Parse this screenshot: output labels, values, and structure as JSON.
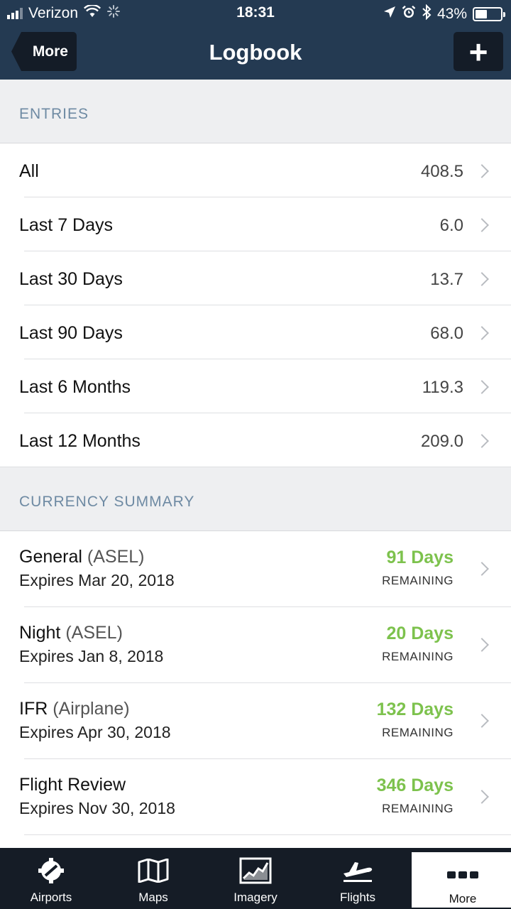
{
  "status_bar": {
    "carrier": "Verizon",
    "time": "18:31",
    "battery_percent": "43%",
    "icons": [
      "signal-icon",
      "wifi-icon",
      "activity-icon",
      "location-icon",
      "alarm-icon",
      "bluetooth-icon",
      "battery-icon"
    ]
  },
  "nav": {
    "back_label": "More",
    "title": "Logbook",
    "add_label": "+"
  },
  "entries": {
    "header": "ENTRIES",
    "items": [
      {
        "label": "All",
        "value": "408.5"
      },
      {
        "label": "Last 7 Days",
        "value": "6.0"
      },
      {
        "label": "Last 30 Days",
        "value": "13.7"
      },
      {
        "label": "Last 90 Days",
        "value": "68.0"
      },
      {
        "label": "Last 6 Months",
        "value": "119.3"
      },
      {
        "label": "Last 12 Months",
        "value": "209.0"
      }
    ]
  },
  "currency": {
    "header": "CURRENCY SUMMARY",
    "accent_color": "#7dc24d",
    "items": [
      {
        "title": "General",
        "qualifier": "(ASEL)",
        "expires": "Expires Mar 20, 2018",
        "days": "91 Days",
        "remaining": "REMAINING"
      },
      {
        "title": "Night",
        "qualifier": "(ASEL)",
        "expires": "Expires Jan 8, 2018",
        "days": "20 Days",
        "remaining": "REMAINING"
      },
      {
        "title": "IFR",
        "qualifier": "(Airplane)",
        "expires": "Expires Apr 30, 2018",
        "days": "132 Days",
        "remaining": "REMAINING"
      },
      {
        "title": "Flight Review",
        "qualifier": "",
        "expires": "Expires Nov 30, 2018",
        "days": "346 Days",
        "remaining": "REMAINING"
      }
    ]
  },
  "tabs": [
    {
      "label": "Airports",
      "icon": "airport-icon"
    },
    {
      "label": "Maps",
      "icon": "map-icon"
    },
    {
      "label": "Imagery",
      "icon": "imagery-icon"
    },
    {
      "label": "Flights",
      "icon": "flight-icon"
    },
    {
      "label": "More",
      "icon": "more-icon",
      "active": true
    }
  ],
  "colors": {
    "nav_bg": "#243a52",
    "tabbar_bg": "#151c26",
    "section_text": "#6e8aa3"
  }
}
